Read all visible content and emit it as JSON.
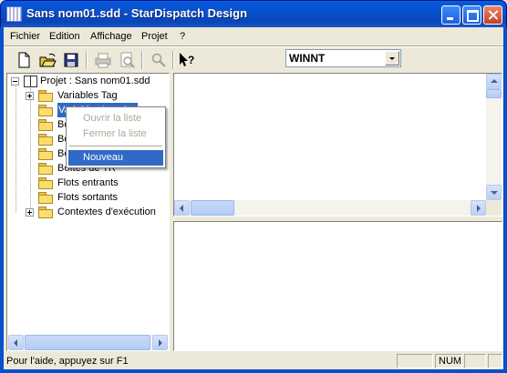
{
  "window": {
    "title": "Sans nom01.sdd - StarDispatch Design",
    "icon": "app-icon"
  },
  "menu": [
    "Fichier",
    "Edition",
    "Affichage",
    "Projet",
    "?"
  ],
  "toolbar": {
    "buttons": [
      "new-file-icon",
      "open-folder-icon",
      "save-icon",
      "print-icon",
      "print-preview-icon",
      "find-icon",
      "context-help-icon"
    ],
    "platform_select": {
      "selected": "WINNT"
    }
  },
  "tree": {
    "root": "Projet : Sans nom01.sdd",
    "items": [
      {
        "label": "Variables Tag",
        "expander": "+"
      },
      {
        "label": "Variables Locales",
        "expander": ""
      },
      {
        "label": "Boites",
        "expander": ""
      },
      {
        "label": "Boites",
        "expander": ""
      },
      {
        "label": "Boites",
        "expander": ""
      },
      {
        "label": "Boîtes de TR",
        "expander": ""
      },
      {
        "label": "Flots entrants",
        "expander": ""
      },
      {
        "label": "Flots sortants",
        "expander": ""
      },
      {
        "label": "Contextes d'exécution",
        "expander": "+"
      }
    ]
  },
  "context_menu": {
    "items": [
      {
        "label": "Ouvrir la liste",
        "state": "disabled"
      },
      {
        "label": "Fermer la liste",
        "state": "disabled"
      },
      {
        "label": "Nouveau",
        "state": "selected"
      }
    ]
  },
  "statusbar": {
    "text": "Pour l'aide, appuyez sur F1",
    "panels": [
      "",
      "NUM",
      "",
      ""
    ]
  }
}
